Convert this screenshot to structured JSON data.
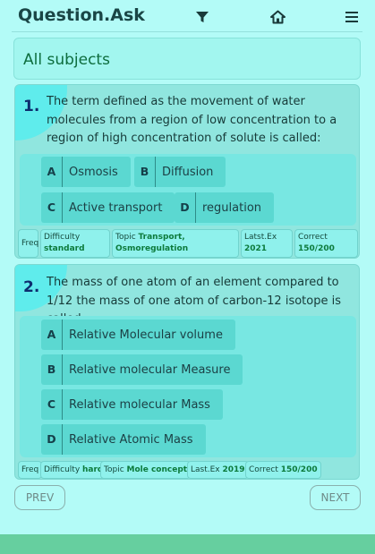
{
  "header": {
    "brand": "Question.Ask",
    "filter_icon": "filter-icon",
    "home_icon": "home-icon",
    "menu_icon": "hamburger-menu-icon"
  },
  "subject": {
    "label": "All subjects"
  },
  "questions": [
    {
      "number": "1.",
      "text": "The term defined as the movement of water molecules from a region of low concentration to a region of high concentration of solute is called:",
      "options": [
        {
          "letter": "A",
          "text": "Osmosis"
        },
        {
          "letter": "B",
          "text": "Diffusion"
        },
        {
          "letter": "C",
          "text": "Active transport"
        },
        {
          "letter": "D",
          "text": "regulation"
        }
      ],
      "meta": {
        "freq": "Freq",
        "difficulty_label": "Difficulty",
        "difficulty": "standard",
        "topic_label": "Topic",
        "topic": "Transport, Osmoregulation",
        "latest_label": "Latst.Ex",
        "latest": "2021",
        "correct_label": "Correct",
        "correct": "150/200"
      }
    },
    {
      "number": "2.",
      "text": "The mass of one atom of an element compared to 1/12 the mass of one atom of carbon-12 isotope is called",
      "options": [
        {
          "letter": "A",
          "text": "Relative Molecular volume"
        },
        {
          "letter": "B",
          "text": "Relative molecular Measure"
        },
        {
          "letter": "C",
          "text": "Relative molecular Mass"
        },
        {
          "letter": "D",
          "text": "Relative Atomic Mass"
        }
      ],
      "meta": {
        "freq": "Freq",
        "difficulty_label": "Difficulty",
        "difficulty": "hard",
        "topic_label": "Topic",
        "topic": "Mole concept",
        "latest_label": "Last.Ex",
        "latest": "2019",
        "correct_label": "Correct",
        "correct": "150/200"
      }
    }
  ],
  "nav": {
    "prev": "PREV",
    "next": "NEXT"
  },
  "colors": {
    "background": "#b3fbf7",
    "card": "#90e6df",
    "option": "#5bd8d1",
    "accent_green": "#0c7a3b",
    "footer": "#66cf9f"
  }
}
